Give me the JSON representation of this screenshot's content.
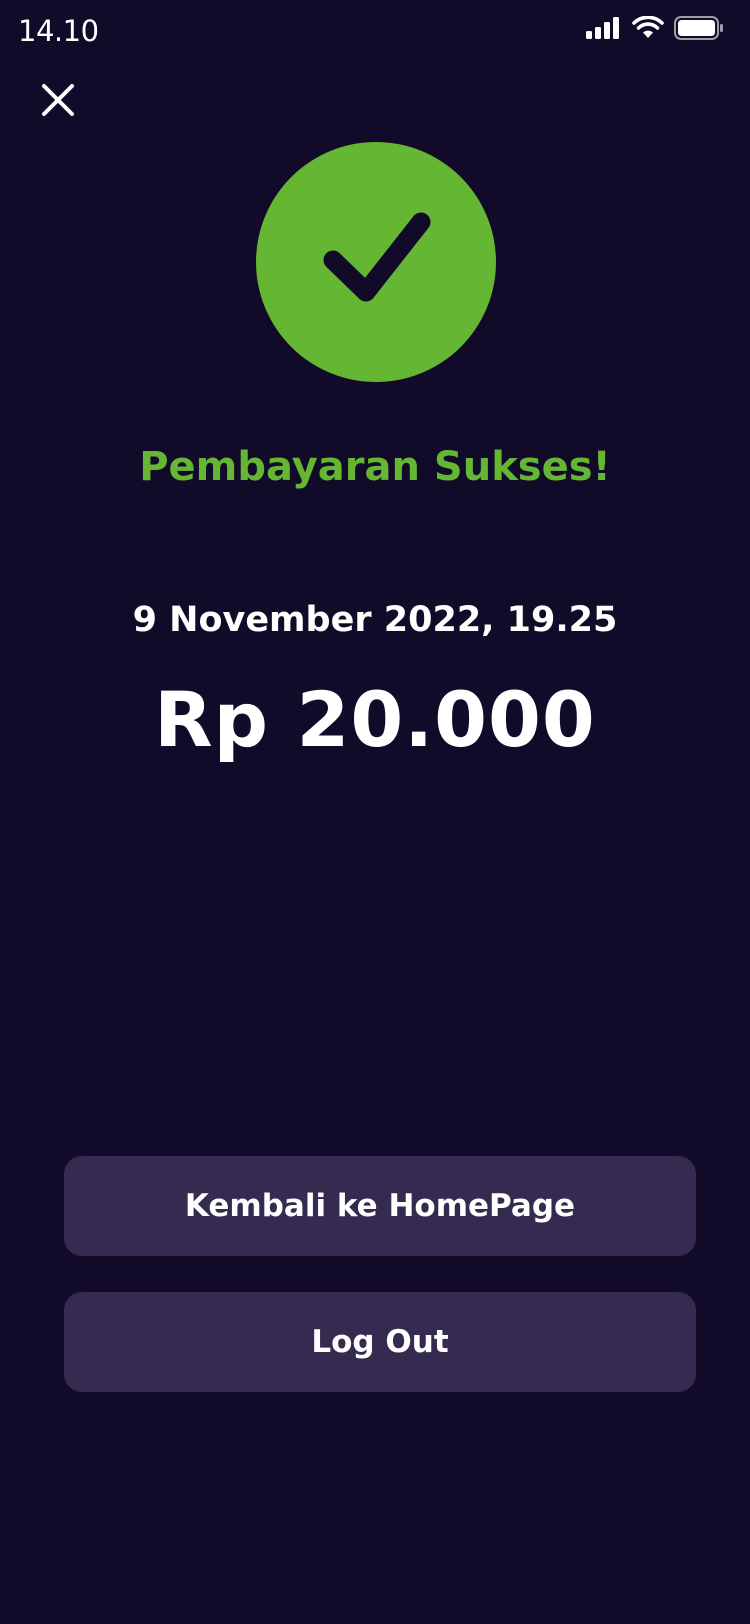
{
  "status_bar": {
    "time": "14.10",
    "icons": [
      "signal-icon",
      "wifi-icon",
      "battery-icon"
    ]
  },
  "header": {
    "close_icon": "close-icon"
  },
  "result": {
    "icon": "checkmark-icon",
    "title": "Pembayaran Sukses!",
    "date": "9 November 2022, 19.25",
    "amount": "Rp 20.000"
  },
  "actions": {
    "home_label": "Kembali ke HomePage",
    "logout_label": "Log Out"
  },
  "colors": {
    "background": "#120a29",
    "success": "#65b733",
    "button": "#352a50",
    "text": "#ffffff"
  }
}
